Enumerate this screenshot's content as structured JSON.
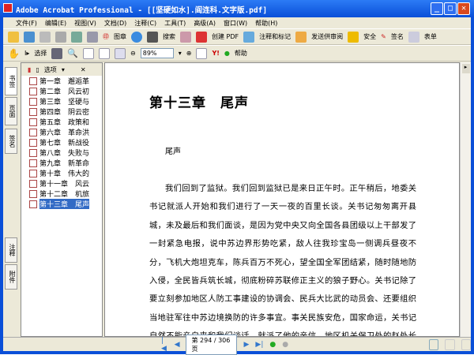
{
  "window": {
    "title": "Adobe Acrobat Professional - [[坚硬如水].阎连科.文字版.pdf]"
  },
  "menu": [
    "文件(F)",
    "编辑(E)",
    "视图(V)",
    "文档(D)",
    "注释(C)",
    "工具(T)",
    "高级(A)",
    "窗口(W)",
    "帮助(H)"
  ],
  "toolbar1": {
    "stamp": "图章",
    "search": "搜索",
    "create_pdf": "创建 PDF",
    "comment": "注释和标记",
    "review": "发送供审阅",
    "secure": "安全",
    "sign": "签名",
    "forms": "表单"
  },
  "toolbar2": {
    "select": "选择",
    "zoom": "89%",
    "help": "帮助"
  },
  "sidebar": {
    "tabs": [
      "书签",
      "页面",
      "签名"
    ],
    "bottom_tabs": [
      "注释",
      "附件"
    ],
    "options": "选项",
    "bookmarks": [
      "第一章　邂逅革",
      "第二章　风云初",
      "第三章　坚硬与",
      "第四章　阴云密",
      "第五章　政策和",
      "第六章　革命洪",
      "第七章　新战役",
      "第八章　失败与",
      "第九章　新革命",
      "第十章　伟大的",
      "第十一章　风云",
      "第十二章　机旅",
      "第十三章　尾声"
    ],
    "selected": 12
  },
  "document": {
    "chapter_title": "第十三章　尾声",
    "section": "尾声",
    "body": "我们回到了监狱。我们回到监狱已是来日正午时。正午稍后，地委关书记就派人开始和我们进行了一天一夜的百里长谈。关书记匆匆离开县城，未及最后和我们面谈，是因为党中央又向全国各县团级以上干部发了一封紧急电报，说中苏边界形势吃紧，敌人往我珍宝岛一侧调兵昼夜不分，飞机大炮坦克车，陈兵百万不死心，望全国全军团结紧，随时随地防入侵，全民皆兵筑长城，彻底粉碎苏联修正主义的狼子野心。关书记除了要立刻参加地区人防工事建设的协调会、民兵大比武的动员会、还要组织当地驻军往中苏边境换防的许多事宜。事关民族安危，国家命运，关书记自然不能亲自来和我们谈话，就派了他的亲信、地区机关保卫处的赵处长和我们"
  },
  "status": {
    "page": "第 294 / 306 页"
  }
}
